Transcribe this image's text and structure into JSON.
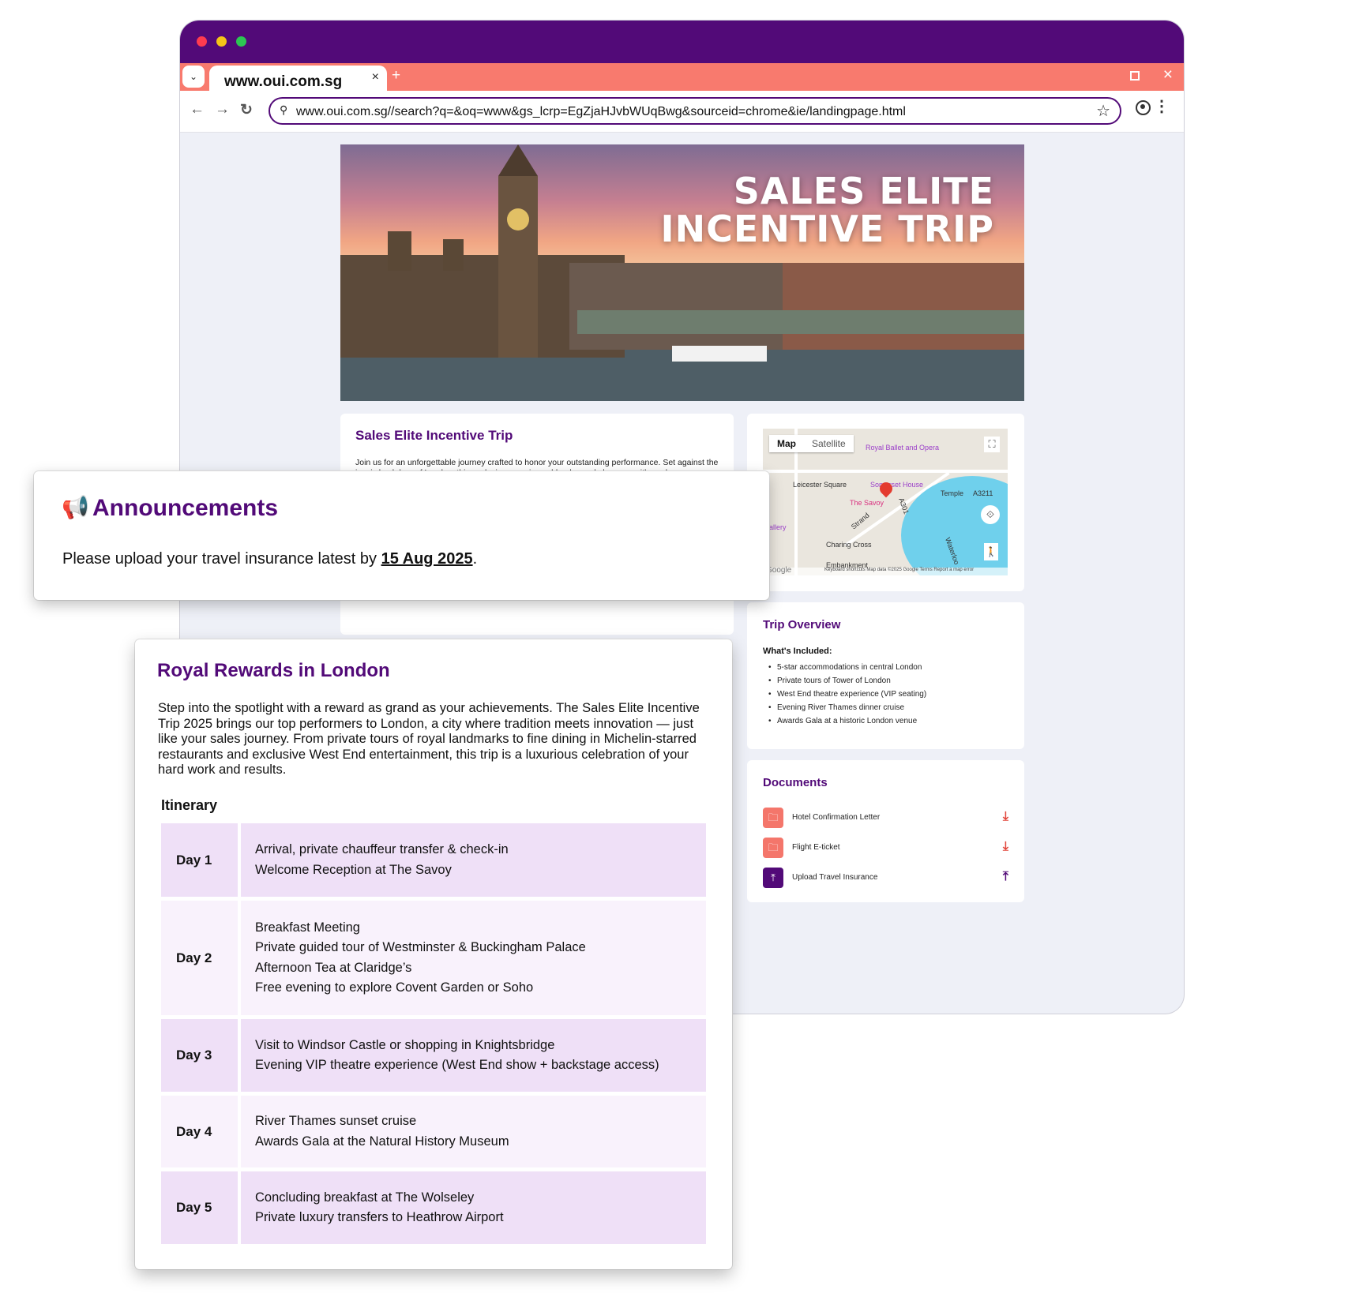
{
  "browser": {
    "tab_title": "www.oui.com.sg",
    "tab_close": "×",
    "tab_new": "+",
    "dropdown": "⌄",
    "url": "www.oui.com.sg//search?q=&oq=www&gs_lcrp=EgZjaHJvbWUqBwg&sourceid=chrome&ie/landingpage.html",
    "back": "←",
    "forward": "→",
    "reload": "↻",
    "search_icon": "⚲",
    "bookmark": "☆",
    "menu": "⋮",
    "window_close": "×"
  },
  "hero": {
    "title_line1": "SALES ELITE",
    "title_line2": "INCENTIVE TRIP"
  },
  "trip_card": {
    "title": "Sales Elite Incentive Trip",
    "description": "Join us for an unforgettable journey crafted to honor your outstanding performance. Set against the iconic backdrop of London, this exclusive experience blends royal elegance with modern"
  },
  "map": {
    "tab_map": "Map",
    "tab_satellite": "Satellite",
    "fullscreen": "⛶",
    "rotate": "⟐",
    "pegman": "🚶",
    "labels": {
      "royal_ballet": "Royal Ballet and Opera",
      "leicester": "Leicester Square",
      "somerset": "Somerset House",
      "temple": "Temple",
      "a3211": "A3211",
      "savoy": "The Savoy",
      "strand": "Strand",
      "charing": "Charing Cross",
      "embankment": "Embankment",
      "gallery": "allery",
      "a301": "A301",
      "waterloo": "Waterloo"
    },
    "google": "Google",
    "footer": "Keyboard shortcuts    Map data ©2025 Google    Terms    Report a map error"
  },
  "overview": {
    "title": "Trip Overview",
    "included_heading": "What's Included:",
    "items": [
      "5-star accommodations in central London",
      "Private tours of Tower of London",
      "West End theatre experience (VIP seating)",
      "Evening River Thames dinner cruise",
      "Awards Gala at a historic London venue"
    ]
  },
  "documents": {
    "title": "Documents",
    "items": [
      {
        "label": "Hotel Confirmation Letter",
        "icon": "folder-icon",
        "action": "download-icon"
      },
      {
        "label": "Flight E-ticket",
        "icon": "folder-icon",
        "action": "download-icon"
      },
      {
        "label": "Upload Travel Insurance",
        "icon": "upload-icon",
        "action": "upload-icon"
      }
    ],
    "folder_glyph": "🗀",
    "download_glyph": "⤓",
    "upload_glyph": "⤒"
  },
  "announcement": {
    "icon": "📢",
    "title": "Announcements",
    "text": "Please upload your travel insurance latest by ",
    "date": "15 Aug 2025",
    "suffix": "."
  },
  "royal": {
    "title": "Royal Rewards in London",
    "intro": "Step into the spotlight with a reward as grand as your achievements. The Sales Elite Incentive Trip 2025 brings our top performers to London, a city where tradition meets innovation — just like your sales journey. From private tours of royal landmarks to fine dining in Michelin-starred restaurants and exclusive West End entertainment, this trip is a luxurious celebration of your hard work and results.",
    "itinerary_heading": "Itinerary",
    "days": [
      {
        "day": "Day 1",
        "activities": [
          "Arrival, private chauffeur transfer & check-in",
          "Welcome Reception at The Savoy"
        ]
      },
      {
        "day": "Day 2",
        "activities": [
          "Breakfast Meeting",
          "Private guided tour of Westminster & Buckingham Palace",
          "Afternoon Tea at Claridge’s",
          "Free evening to explore Covent Garden or Soho"
        ]
      },
      {
        "day": "Day 3",
        "activities": [
          "Visit to Windsor Castle or shopping in Knightsbridge",
          "Evening VIP theatre experience (West End show + backstage access)"
        ]
      },
      {
        "day": "Day 4",
        "activities": [
          "River Thames sunset cruise",
          "Awards Gala at the Natural History Museum"
        ]
      },
      {
        "day": "Day 5",
        "activities": [
          "Concluding breakfast at The Wolseley",
          "Private luxury transfers to Heathrow Airport"
        ]
      }
    ]
  },
  "colors": {
    "brand_purple": "#520a78",
    "tab_coral": "#f87a6e",
    "itinerary_dark": "#efe0f7",
    "itinerary_light": "#f9f2fc"
  }
}
